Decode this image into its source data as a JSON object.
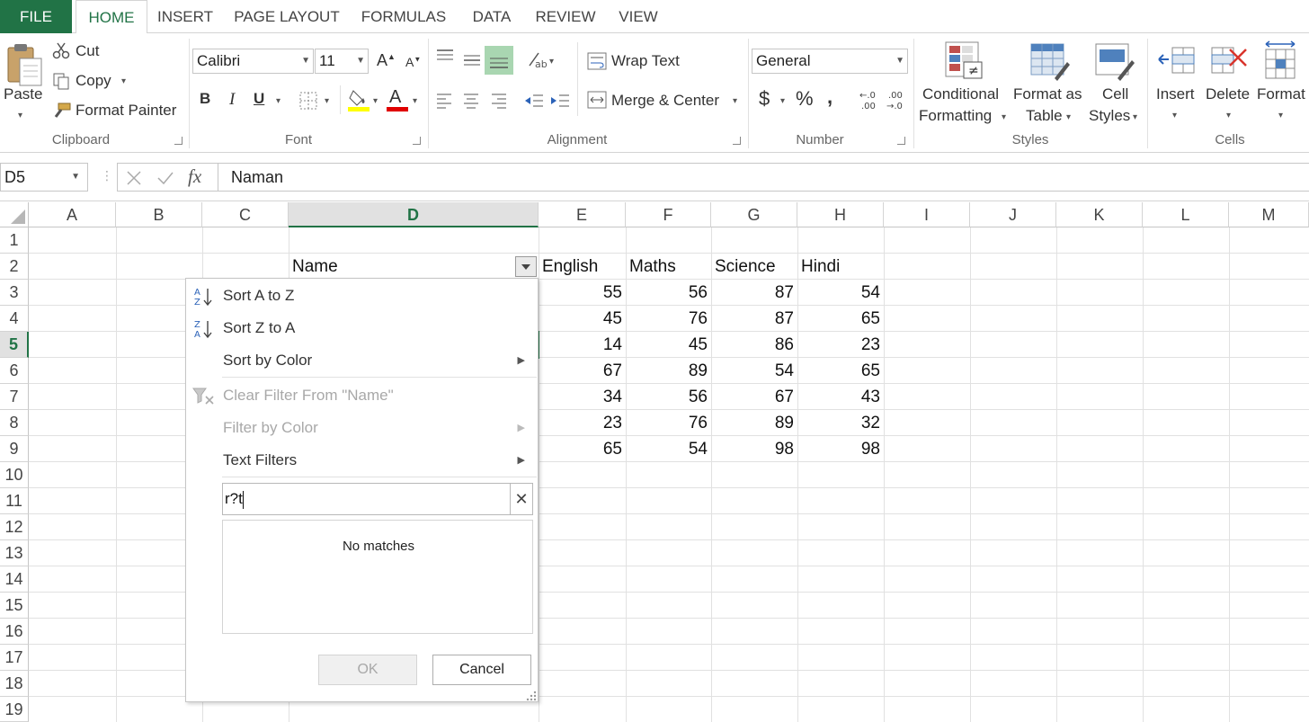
{
  "tabs": [
    "FILE",
    "HOME",
    "INSERT",
    "PAGE LAYOUT",
    "FORMULAS",
    "DATA",
    "REVIEW",
    "VIEW"
  ],
  "active_tab": "HOME",
  "clipboard": {
    "paste": "Paste",
    "cut": "Cut",
    "copy": "Copy",
    "format_painter": "Format Painter",
    "group": "Clipboard"
  },
  "font": {
    "name": "Calibri",
    "size": "11",
    "bold": "B",
    "italic": "I",
    "underline": "U",
    "group": "Font"
  },
  "alignment": {
    "wrap_text": "Wrap Text",
    "merge_center": "Merge & Center",
    "group": "Alignment"
  },
  "number": {
    "format": "General",
    "currency": "$",
    "percent": "%",
    "comma": ",",
    "group": "Number"
  },
  "styles": {
    "conditional_1": "Conditional",
    "conditional_2": "Formatting",
    "format_table_1": "Format as",
    "format_table_2": "Table",
    "cell_styles_1": "Cell",
    "cell_styles_2": "Styles",
    "group": "Styles"
  },
  "cells": {
    "insert": "Insert",
    "delete": "Delete",
    "format": "Format",
    "group": "Cells"
  },
  "formula_bar": {
    "name_box": "D5",
    "value": "Naman"
  },
  "columns": [
    "A",
    "B",
    "C",
    "D",
    "E",
    "F",
    "G",
    "H",
    "I",
    "J",
    "K",
    "L",
    "M"
  ],
  "rows": [
    "1",
    "2",
    "3",
    "4",
    "5",
    "6",
    "7",
    "8",
    "9",
    "10",
    "11",
    "12",
    "13",
    "14",
    "15",
    "16",
    "17",
    "18",
    "19"
  ],
  "selected_column": "D",
  "selected_row": "5",
  "table": {
    "headers": [
      "Name",
      "English",
      "Maths",
      "Science",
      "Hindi"
    ],
    "rows": [
      [
        "55",
        "56",
        "87",
        "54"
      ],
      [
        "45",
        "76",
        "87",
        "65"
      ],
      [
        "14",
        "45",
        "86",
        "23"
      ],
      [
        "67",
        "89",
        "54",
        "65"
      ],
      [
        "34",
        "56",
        "67",
        "43"
      ],
      [
        "23",
        "76",
        "89",
        "32"
      ],
      [
        "65",
        "54",
        "98",
        "98"
      ]
    ]
  },
  "filter_menu": {
    "sort_az": "Sort A to Z",
    "sort_za": "Sort Z to A",
    "sort_color": "Sort by Color",
    "clear_filter": "Clear Filter From \"Name\"",
    "filter_color": "Filter by Color",
    "text_filters": "Text Filters",
    "search_value": "r?t",
    "no_matches": "No matches",
    "ok": "OK",
    "cancel": "Cancel"
  },
  "colors": {
    "accent": "#217346",
    "selection_header": "#e1e1e1",
    "font_color": "#e00000",
    "highlight": "#ffff00"
  }
}
